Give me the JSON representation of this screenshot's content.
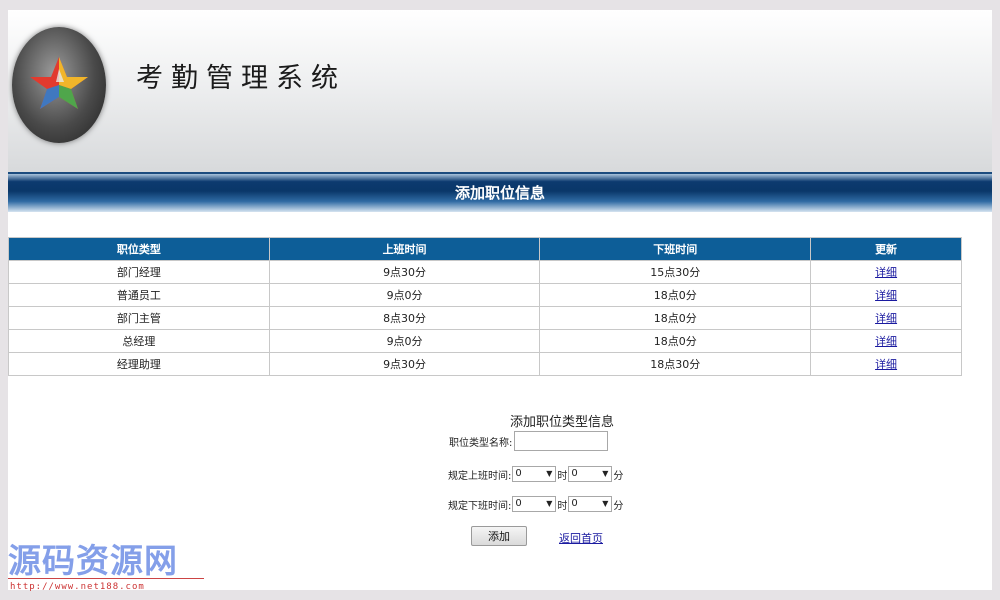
{
  "header": {
    "app_title": "考勤管理系统"
  },
  "section": {
    "title": "添加职位信息"
  },
  "table": {
    "columns": [
      "职位类型",
      "上班时间",
      "下班时间",
      "更新"
    ],
    "rows": [
      {
        "type": "部门经理",
        "start": "9点30分",
        "end": "15点30分",
        "action": "详细"
      },
      {
        "type": "普通员工",
        "start": "9点0分",
        "end": "18点0分",
        "action": "详细"
      },
      {
        "type": "部门主管",
        "start": "8点30分",
        "end": "18点0分",
        "action": "详细"
      },
      {
        "type": "总经理",
        "start": "9点0分",
        "end": "18点0分",
        "action": "详细"
      },
      {
        "type": "经理助理",
        "start": "9点30分",
        "end": "18点30分",
        "action": "详细"
      }
    ]
  },
  "form": {
    "title": "添加职位类型信息",
    "name_label": "职位类型名称:",
    "name_value": "",
    "start_label": "规定上班时间:",
    "end_label": "规定下班时间:",
    "start_hour": "0",
    "start_minute": "0",
    "end_hour": "0",
    "end_minute": "0",
    "hour_unit": "时",
    "minute_unit": "分",
    "add_label": "添加",
    "back_label": "返回首页"
  },
  "watermark": {
    "text": "源码资源网",
    "url": "http://www.net188.com"
  }
}
